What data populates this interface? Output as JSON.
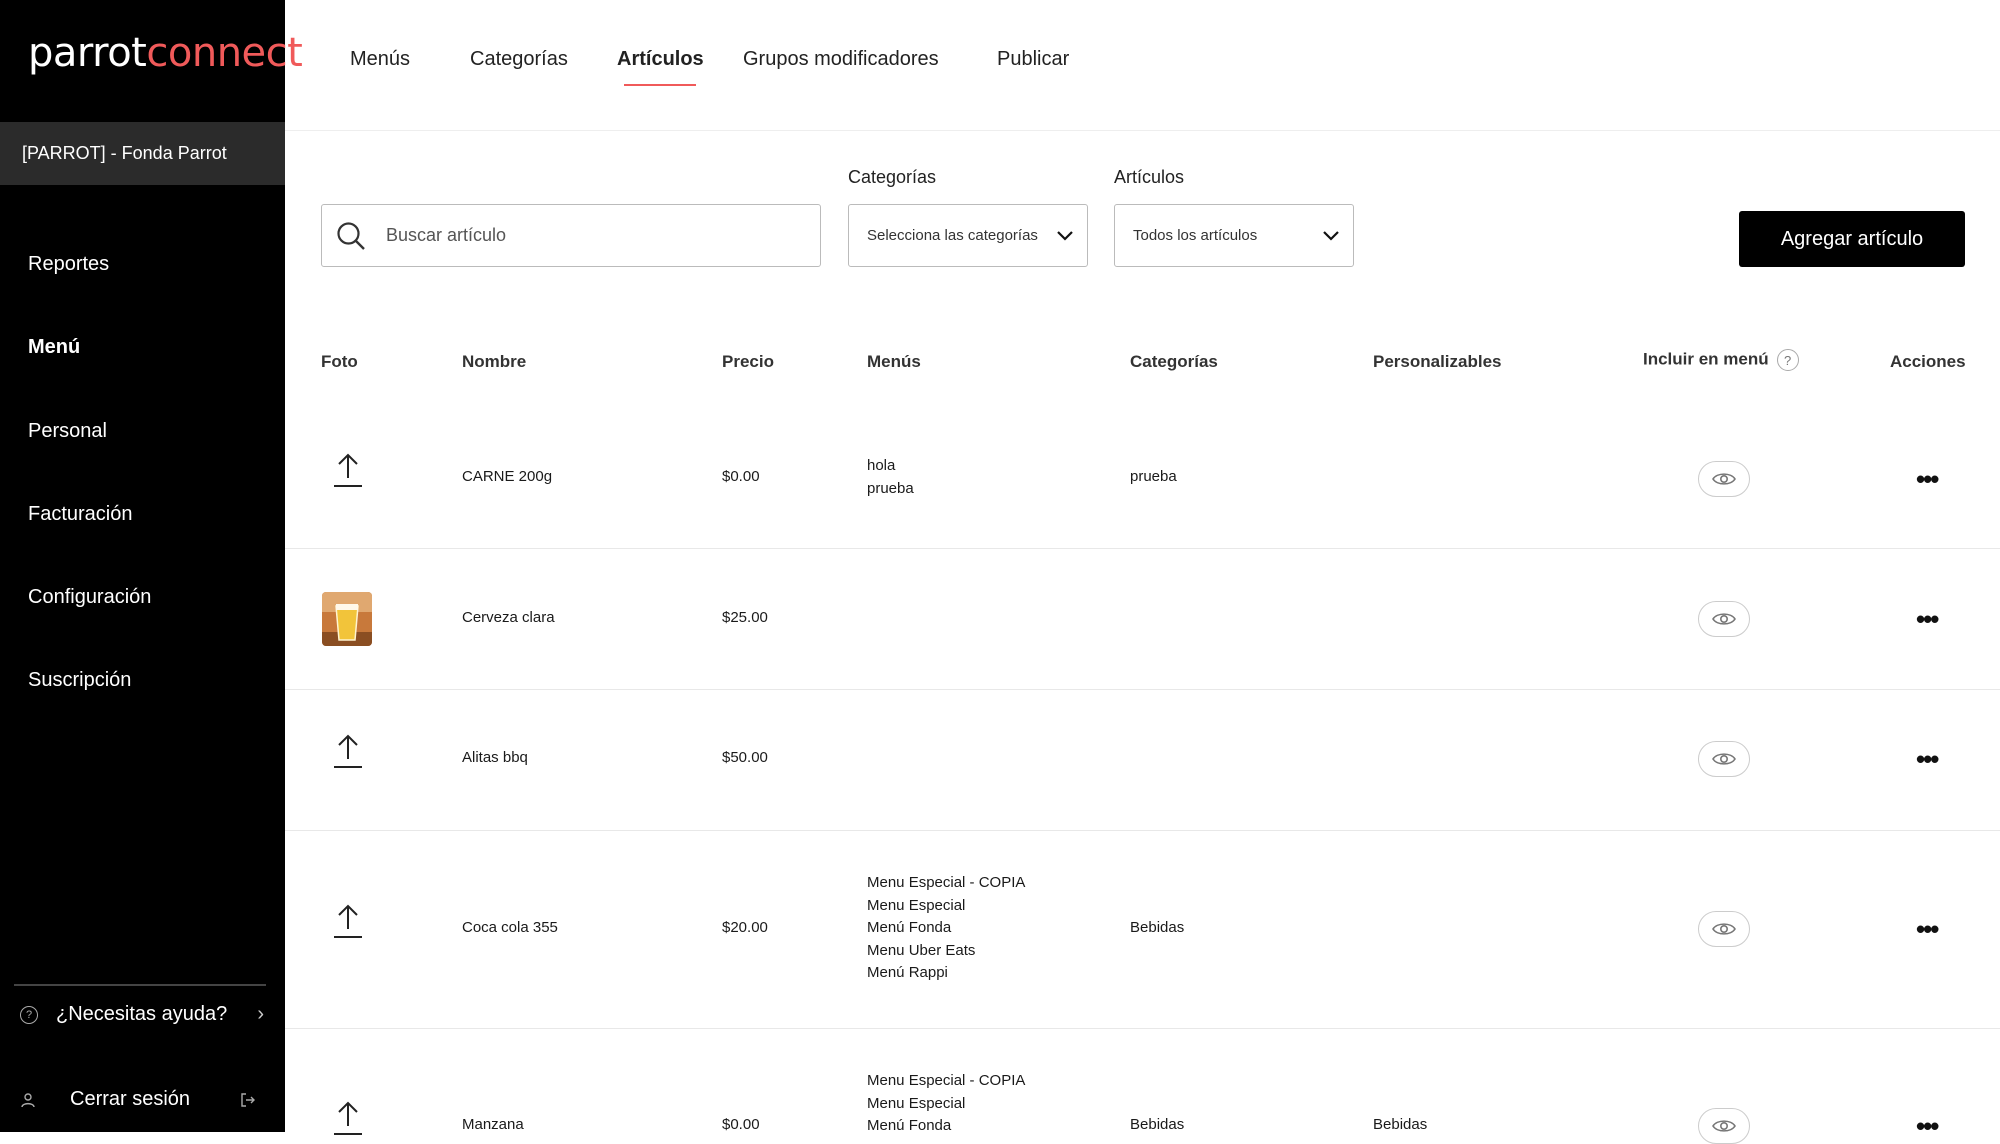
{
  "sidebar": {
    "logo_part1": "parrot",
    "logo_part2": "connect",
    "restaurant": "[PARROT] - Fonda Parrot",
    "items": [
      {
        "label": "Reportes"
      },
      {
        "label": "Menú"
      },
      {
        "label": "Personal"
      },
      {
        "label": "Facturación"
      },
      {
        "label": "Configuración"
      },
      {
        "label": "Suscripción"
      }
    ],
    "help_label": "¿Necesitas ayuda?",
    "logout_label": "Cerrar sesión"
  },
  "tabs": [
    {
      "label": "Menús"
    },
    {
      "label": "Categorías"
    },
    {
      "label": "Artículos"
    },
    {
      "label": "Grupos modificadores"
    },
    {
      "label": "Publicar"
    }
  ],
  "filters": {
    "search_placeholder": "Buscar artículo",
    "categories_label": "Categorías",
    "categories_value": "Selecciona las categorías",
    "articles_label": "Artículos",
    "articles_value": "Todos los artículos"
  },
  "add_button": "Agregar artículo",
  "table": {
    "headers": {
      "foto": "Foto",
      "nombre": "Nombre",
      "precio": "Precio",
      "menus": "Menús",
      "categorias": "Categorías",
      "personalizables": "Personalizables",
      "incluir": "Incluir en menú",
      "acciones": "Acciones"
    },
    "rows": [
      {
        "name": "CARNE 200g",
        "price": "$0.00",
        "menus": "hola\nprueba",
        "categories": "prueba",
        "custom": ""
      },
      {
        "name": "Cerveza clara",
        "price": "$25.00",
        "menus": "",
        "categories": "",
        "custom": ""
      },
      {
        "name": "Alitas bbq",
        "price": "$50.00",
        "menus": "",
        "categories": "",
        "custom": ""
      },
      {
        "name": "Coca cola 355",
        "price": "$20.00",
        "menus": "Menu Especial - COPIA\nMenu Especial\nMenú Fonda\nMenu Uber Eats\nMenú Rappi",
        "categories": "Bebidas",
        "custom": ""
      },
      {
        "name": "Manzana",
        "price": "$0.00",
        "menus": "Menu Especial - COPIA\nMenu Especial\nMenú Fonda",
        "categories": "Bebidas",
        "custom": "Bebidas"
      }
    ]
  },
  "colors": {
    "accent": "#f05a5a",
    "sidebar_bg": "#000000",
    "button_bg": "#000000"
  }
}
